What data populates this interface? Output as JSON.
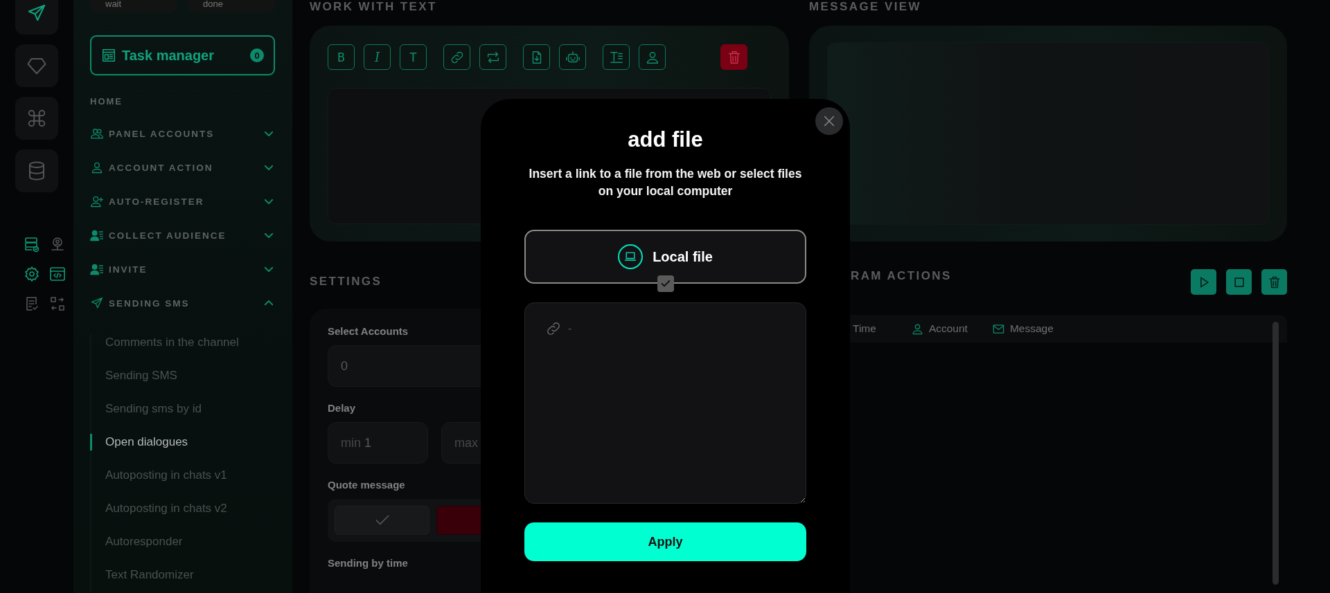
{
  "rail": {
    "items": [
      {
        "kind": "send",
        "selected": true
      },
      {
        "kind": "diamond",
        "selected": false
      },
      {
        "kind": "command",
        "selected": false
      },
      {
        "kind": "database",
        "selected": false
      }
    ],
    "tools": [
      {
        "kind": "server",
        "highlighted": true
      },
      {
        "kind": "user-pin",
        "highlighted": false
      },
      {
        "kind": "gear",
        "highlighted": true
      },
      {
        "kind": "code",
        "highlighted": true
      },
      {
        "kind": "doc-check",
        "highlighted": false
      },
      {
        "kind": "swap",
        "highlighted": false
      }
    ]
  },
  "sidebar": {
    "status_fields": [
      "wait",
      "done"
    ],
    "task_manager": {
      "label": "Task manager",
      "count": "0"
    },
    "home": "HOME",
    "sections": [
      {
        "kind": "users",
        "label": "PANEL ACCOUNTS",
        "expanded": false
      },
      {
        "kind": "user",
        "label": "ACCOUNT ACTION",
        "expanded": false
      },
      {
        "kind": "user-plus",
        "label": "AUTO-REGISTER",
        "expanded": false
      },
      {
        "kind": "user-list",
        "label": "COLLECT AUDIENCE",
        "expanded": false
      },
      {
        "kind": "user-list",
        "label": "INVITE",
        "expanded": false
      },
      {
        "kind": "send",
        "label": "SENDING SMS",
        "expanded": true,
        "children": [
          {
            "label": "Comments in the channel",
            "selected": false
          },
          {
            "label": "Sending SMS",
            "selected": false
          },
          {
            "label": "Sending sms by id",
            "selected": false
          },
          {
            "label": "Open dialogues",
            "selected": true
          },
          {
            "label": "Autoposting in chats v1",
            "selected": false
          },
          {
            "label": "Autoposting in chats v2",
            "selected": false
          },
          {
            "label": "Autoresponder",
            "selected": false
          },
          {
            "label": "Text Randomizer",
            "selected": false
          }
        ]
      }
    ]
  },
  "work_with_text": {
    "title": "WORK WITH TEXT",
    "toolbar": [
      [
        {
          "kind": "text",
          "label": "B"
        },
        {
          "kind": "italic",
          "label": "I"
        },
        {
          "kind": "text",
          "label": "T"
        }
      ],
      [
        {
          "kind": "link"
        },
        {
          "kind": "repeat"
        }
      ],
      [
        {
          "kind": "file"
        },
        {
          "kind": "bot"
        }
      ],
      [
        {
          "kind": "lines"
        },
        {
          "kind": "user"
        }
      ]
    ],
    "delete_button": {
      "kind": "trash"
    }
  },
  "settings": {
    "title": "SETTINGS",
    "select_accounts": {
      "label": "Select Accounts",
      "value": "0"
    },
    "delay": {
      "label": "Delay",
      "min": {
        "label": "min",
        "value": "1"
      },
      "max": {
        "label": "max"
      }
    },
    "quote_message": {
      "label": "Quote message",
      "options": [
        {
          "kind": "yes",
          "selected": false
        },
        {
          "kind": "no",
          "selected": true
        }
      ]
    },
    "sending_by_time": {
      "label": "Sending by time"
    }
  },
  "message_view": {
    "title": "MESSAGE VIEW"
  },
  "actions": {
    "title": "RAM ACTIONS",
    "buttons": [
      {
        "kind": "play"
      },
      {
        "kind": "stop"
      },
      {
        "kind": "trash"
      }
    ],
    "columns": [
      {
        "label": "Time"
      },
      {
        "kind": "user",
        "label": "Account"
      },
      {
        "kind": "mail",
        "label": "Message"
      }
    ]
  },
  "modal": {
    "title": "add file",
    "description": "Insert a link to a file from the web or select files on your local computer",
    "local_file": {
      "label": "Local file",
      "checked": true
    },
    "link_field": {
      "placeholder": "-"
    },
    "apply": "Apply"
  }
}
